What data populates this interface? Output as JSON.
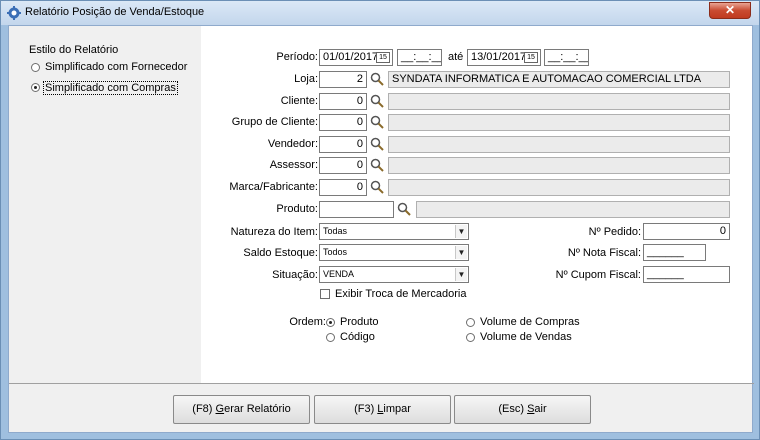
{
  "window": {
    "title": "Relatório Posição de Venda/Estoque",
    "close_label": "✕"
  },
  "estilo": {
    "heading": "Estilo do Relatório",
    "options": [
      {
        "label": "Simplificado com Fornecedor",
        "selected": false
      },
      {
        "label": "Simplificado com Compras",
        "selected": true
      }
    ]
  },
  "periodo": {
    "label": "Período:",
    "date_from": "01/01/2017",
    "time_from": "__:__:__",
    "separator": "até",
    "date_to": "13/01/2017",
    "time_to": "__:__:__",
    "calendar_icon_text": "15"
  },
  "loja": {
    "label": "Loja:",
    "value": "2",
    "description": "SYNDATA INFORMATICA E AUTOMACAO COMERCIAL LTDA"
  },
  "cliente": {
    "label": "Cliente:",
    "value": "0",
    "description": ""
  },
  "grupo_cliente": {
    "label": "Grupo de Cliente:",
    "value": "0",
    "description": ""
  },
  "vendedor": {
    "label": "Vendedor:",
    "value": "0",
    "description": ""
  },
  "assessor": {
    "label": "Assessor:",
    "value": "0",
    "description": ""
  },
  "marca": {
    "label": "Marca/Fabricante:",
    "value": "0",
    "description": ""
  },
  "produto": {
    "label": "Produto:",
    "value": "",
    "description": ""
  },
  "natureza": {
    "label": "Natureza do Item:",
    "value": "Todas"
  },
  "saldo": {
    "label": "Saldo Estoque:",
    "value": "Todos"
  },
  "situacao": {
    "label": "Situação:",
    "value": "VENDA"
  },
  "pedido": {
    "label": "Nº Pedido:",
    "value": "0"
  },
  "nota_fiscal": {
    "label": "Nº Nota Fiscal:",
    "value": "______"
  },
  "cupom_fiscal": {
    "label": "Nº Cupom Fiscal:",
    "value": "______"
  },
  "exibir_troca": {
    "label": "Exibir Troca de Mercadoria",
    "checked": false
  },
  "ordem": {
    "label": "Ordem:",
    "options": [
      {
        "label": "Produto",
        "selected": true
      },
      {
        "label": "Código",
        "selected": false
      },
      {
        "label": "Volume de Compras",
        "selected": false
      },
      {
        "label": "Volume de Vendas",
        "selected": false
      }
    ]
  },
  "buttons": {
    "gerar": {
      "prefix": "(F8) ",
      "underlined": "G",
      "rest": "erar Relatório"
    },
    "limpar": {
      "prefix": "(F3) ",
      "underlined": "L",
      "rest": "impar"
    },
    "sair": {
      "prefix": "(Esc) ",
      "underlined": "S",
      "rest": "air"
    }
  },
  "colors": {
    "window_frame": "#9fbfdf",
    "close_button": "#c94b31",
    "panel_bg": "#f0f0f0",
    "disabled_field": "#ebebeb"
  },
  "icons": {
    "app": "app-logo-icon",
    "calendar": "calendar-icon",
    "lookup": "magnifier-icon",
    "dropdown": "dropdown-arrow-icon"
  }
}
